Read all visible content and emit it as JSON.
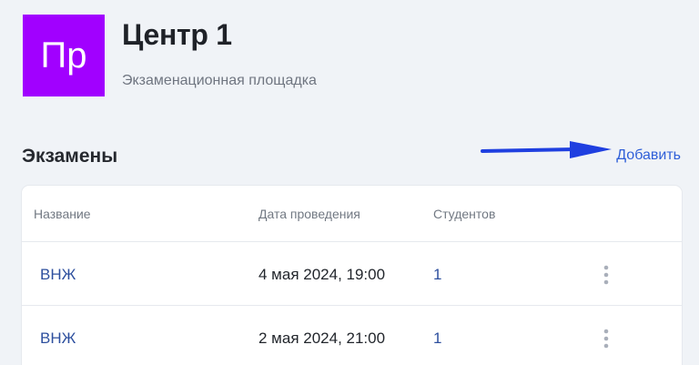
{
  "center": {
    "avatar_text": "Пр",
    "title": "Центр 1",
    "subtitle": "Экзаменационная площадка"
  },
  "exams_section": {
    "title": "Экзамены",
    "add_label": "Добавить"
  },
  "table": {
    "columns": [
      "Название",
      "Дата проведения",
      "Студентов"
    ],
    "rows": [
      {
        "name": "ВНЖ",
        "date": "4 мая 2024, 19:00",
        "students": "1",
        "menu_icon": "kebab-menu-icon"
      },
      {
        "name": "ВНЖ",
        "date": "2 мая 2024, 21:00",
        "students": "1",
        "menu_icon": "kebab-menu-icon"
      }
    ]
  },
  "colors": {
    "avatar_bg": "#a100ff",
    "link": "#2f5fd8",
    "arrow": "#1f3fe0",
    "page_bg": "#f0f3f7"
  }
}
